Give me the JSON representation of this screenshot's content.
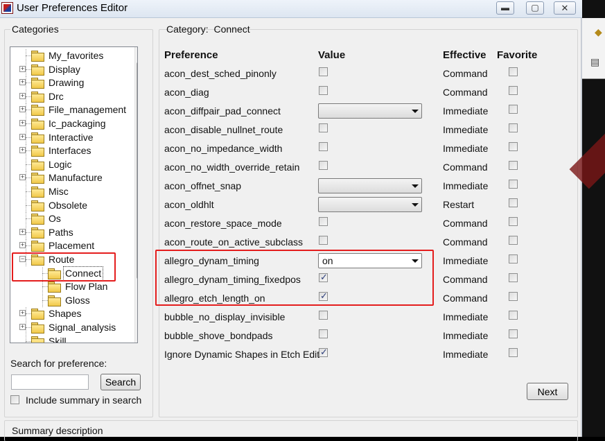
{
  "window": {
    "title": "User Preferences Editor",
    "minimize": "▬",
    "maximize": "▢",
    "close": "✕"
  },
  "categories": {
    "label": "Categories",
    "items": [
      {
        "label": "My_favorites",
        "expander": ""
      },
      {
        "label": "Display",
        "expander": "+"
      },
      {
        "label": "Drawing",
        "expander": "+"
      },
      {
        "label": "Drc",
        "expander": "+"
      },
      {
        "label": "File_management",
        "expander": "+"
      },
      {
        "label": "Ic_packaging",
        "expander": "+"
      },
      {
        "label": "Interactive",
        "expander": "+"
      },
      {
        "label": "Interfaces",
        "expander": "+"
      },
      {
        "label": "Logic",
        "expander": ""
      },
      {
        "label": "Manufacture",
        "expander": "+"
      },
      {
        "label": "Misc",
        "expander": ""
      },
      {
        "label": "Obsolete",
        "expander": ""
      },
      {
        "label": "Os",
        "expander": ""
      },
      {
        "label": "Paths",
        "expander": "+"
      },
      {
        "label": "Placement",
        "expander": "+"
      },
      {
        "label": "Route",
        "expander": "−"
      },
      {
        "label": "Connect",
        "expander": "",
        "child": true,
        "selected": true
      },
      {
        "label": "Flow Plan",
        "expander": "",
        "child": true
      },
      {
        "label": "Gloss",
        "expander": "",
        "child": true
      },
      {
        "label": "Shapes",
        "expander": "+"
      },
      {
        "label": "Signal_analysis",
        "expander": "+"
      },
      {
        "label": "Skill",
        "expander": ""
      }
    ]
  },
  "search": {
    "label": "Search for preference:",
    "value": "",
    "button": "Search",
    "include_summary": "Include summary in search",
    "include_checked": false
  },
  "category": {
    "label": "Category:",
    "name": "Connect"
  },
  "columns": {
    "preference": "Preference",
    "value": "Value",
    "effective": "Effective",
    "favorite": "Favorite"
  },
  "preferences": [
    {
      "name": "acon_dest_sched_pinonly",
      "control": "checkbox",
      "checked": false,
      "effective": "Command",
      "favorite": false
    },
    {
      "name": "acon_diag",
      "control": "checkbox",
      "checked": false,
      "effective": "Command",
      "favorite": false
    },
    {
      "name": "acon_diffpair_pad_connect",
      "control": "select",
      "selected": "",
      "effective": "Immediate",
      "favorite": false
    },
    {
      "name": "acon_disable_nullnet_route",
      "control": "checkbox",
      "checked": false,
      "effective": "Immediate",
      "favorite": false
    },
    {
      "name": "acon_no_impedance_width",
      "control": "checkbox",
      "checked": false,
      "effective": "Immediate",
      "favorite": false
    },
    {
      "name": "acon_no_width_override_retain",
      "control": "checkbox",
      "checked": false,
      "effective": "Command",
      "favorite": false
    },
    {
      "name": "acon_offnet_snap",
      "control": "select",
      "selected": "",
      "effective": "Immediate",
      "favorite": false
    },
    {
      "name": "acon_oldhlt",
      "control": "select",
      "selected": "",
      "effective": "Restart",
      "favorite": false
    },
    {
      "name": "acon_restore_space_mode",
      "control": "checkbox",
      "checked": false,
      "effective": "Command",
      "favorite": false
    },
    {
      "name": "acon_route_on_active_subclass",
      "control": "checkbox",
      "checked": false,
      "effective": "Command",
      "favorite": false
    },
    {
      "name": "allegro_dynam_timing",
      "control": "select",
      "selected": "on",
      "effective": "Immediate",
      "favorite": false
    },
    {
      "name": "allegro_dynam_timing_fixedpos",
      "control": "checkbox",
      "checked": true,
      "effective": "Command",
      "favorite": false
    },
    {
      "name": "allegro_etch_length_on",
      "control": "checkbox",
      "checked": true,
      "effective": "Command",
      "favorite": false
    },
    {
      "name": "bubble_no_display_invisible",
      "control": "checkbox",
      "checked": false,
      "effective": "Immediate",
      "favorite": false
    },
    {
      "name": "bubble_shove_bondpads",
      "control": "checkbox",
      "checked": false,
      "effective": "Immediate",
      "favorite": false
    },
    {
      "name": "Ignore Dynamic Shapes in Etch Edit",
      "control": "checkbox",
      "checked": true,
      "effective": "Immediate",
      "favorite": false
    }
  ],
  "next_button": "Next",
  "summary": {
    "label": "Summary description"
  },
  "highlight_color": "#e41d1d"
}
